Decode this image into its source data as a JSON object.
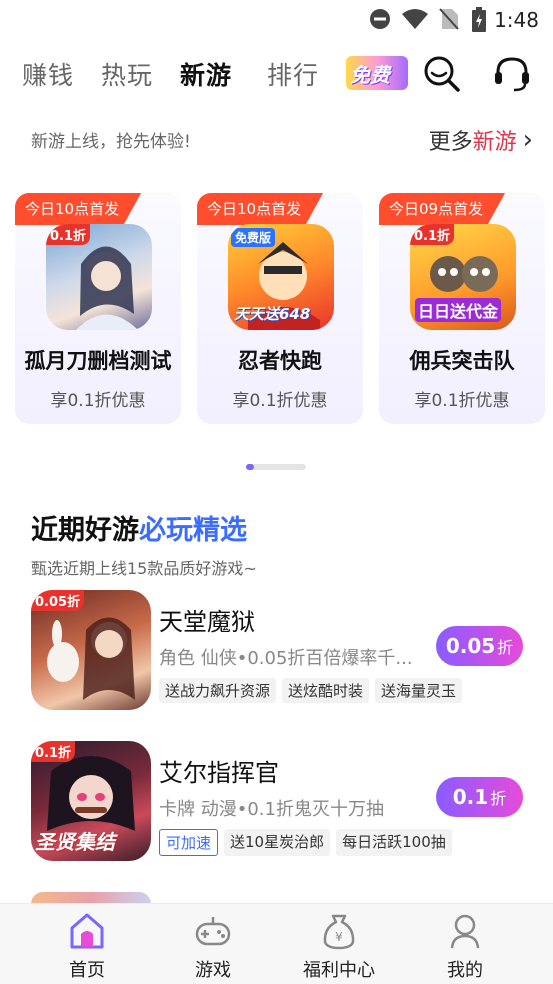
{
  "status_bar": {
    "time": "1:48"
  },
  "tabs": [
    {
      "label": "赚钱"
    },
    {
      "label": "热玩"
    },
    {
      "label": "新游"
    },
    {
      "label": "排行"
    }
  ],
  "free_badge": "免费",
  "promo": {
    "text": "新游上线，抢先体验!",
    "more_prefix": "更多",
    "more_highlight": "新游",
    "more_arrow": "›"
  },
  "cards": [
    {
      "tag": "今日10点首发",
      "name": "孤月刀删档测试",
      "sub": "享0.1折优惠",
      "icon_badge": "0.1折"
    },
    {
      "tag": "今日10点首发",
      "name": "忍者快跑",
      "sub": "享0.1折优惠",
      "icon_badge": "免费版",
      "icon_caption": "天天送648"
    },
    {
      "tag": "今日09点首发",
      "name": "佣兵突击队",
      "sub": "享0.1折优惠",
      "icon_badge": "0.1折",
      "icon_caption": "日日送代金"
    }
  ],
  "pager": {
    "current": 1,
    "total": 2
  },
  "section": {
    "title_prefix": "近期好游",
    "title_highlight": "必玩精选",
    "subtitle": "甄选近期上线15款品质好游戏~"
  },
  "games": [
    {
      "name": "天堂魔狱",
      "desc": "角色 仙侠•0.05折百倍爆率千...",
      "chips": [
        "送战力飙升资源",
        "送炫酷时装",
        "送海量灵玉"
      ],
      "discount": "0.05",
      "discount_unit": "折",
      "icon_badge": "0.05折"
    },
    {
      "name": "艾尔指挥官",
      "desc": "卡牌 动漫•0.1折鬼灭十万抽",
      "accel": "可加速",
      "chips": [
        "送10星炭治郎",
        "每日活跃100抽"
      ],
      "discount": "0.1",
      "discount_unit": "折",
      "icon_badge": "0.1折",
      "icon_caption": "圣贤集结"
    }
  ],
  "bottom_nav": [
    {
      "label": "首页",
      "icon": "home-icon"
    },
    {
      "label": "游戏",
      "icon": "gamepad-icon"
    },
    {
      "label": "福利中心",
      "icon": "money-bag-icon"
    },
    {
      "label": "我的",
      "icon": "user-icon"
    }
  ],
  "colors": {
    "accent_red": "#e0344c",
    "accent_blue": "#3a6cff",
    "tag_orange": "#ff4d2e",
    "discount_start": "#8a5cff",
    "discount_end": "#e64bd9"
  }
}
